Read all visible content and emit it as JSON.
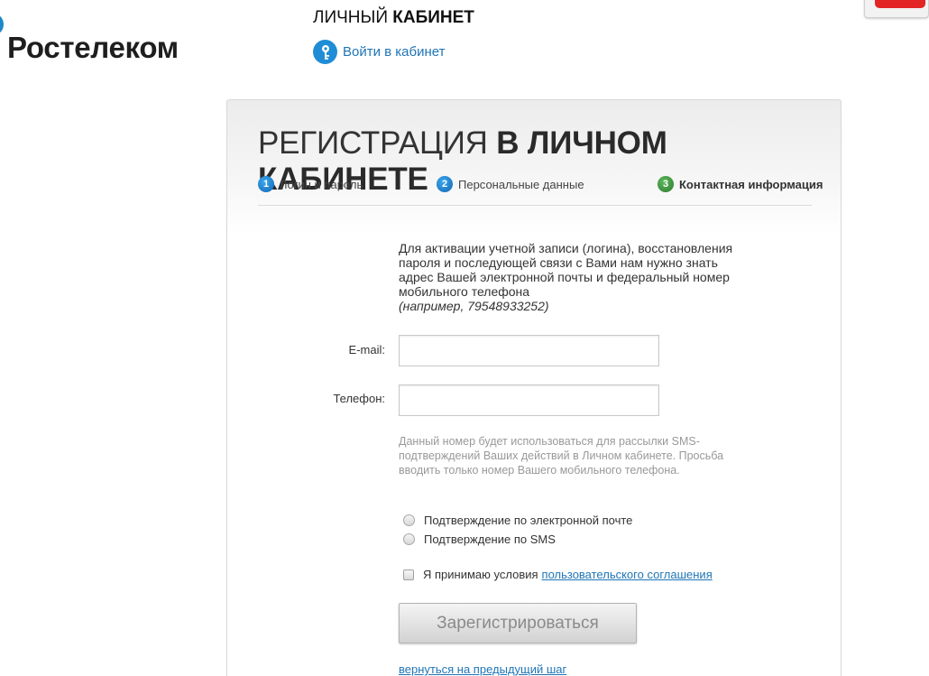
{
  "header": {
    "logo_text": "Ростелеком",
    "cabinet_title_light": "ЛИЧНЫЙ",
    "cabinet_title_bold": "КАБИНЕТ",
    "login_link": "Войти в кабинет"
  },
  "registration": {
    "title_light": "РЕГИСТРАЦИЯ",
    "title_bold": "В ЛИЧНОМ КАБИНЕТЕ",
    "steps": [
      {
        "num": "1",
        "label": "Логин и пароль",
        "active": false
      },
      {
        "num": "2",
        "label": "Персональные данные",
        "active": false
      },
      {
        "num": "3",
        "label": "Контактная информация",
        "active": true
      }
    ],
    "intro_text": "Для активации учетной записи (логина), восстановления пароля и последующей связи с Вами нам нужно знать адрес Вашей электронной почты и федеральный номер мобильного телефона",
    "intro_example": "(например, 79548933252)",
    "email_label": "E-mail:",
    "email_value": "",
    "phone_label": "Телефон:",
    "phone_value": "",
    "phone_hint": "Данный номер будет использоваться для рассылки SMS-подтверждений Ваших действий в Личном кабинете. Просьба вводить только номер Вашего мобильного телефона.",
    "confirm_options": [
      {
        "label": "Подтверждение по электронной почте",
        "checked": false
      },
      {
        "label": "Подтверждение по SMS",
        "checked": false
      }
    ],
    "agree_text": "Я принимаю условия",
    "agree_link": "пользовательского соглашения",
    "submit_label": "Зарегистрироваться",
    "back_link": "вернуться на предыдущий шаг"
  },
  "colors": {
    "link": "#1f75b6",
    "step_blue": "#1f8dd6",
    "step_green": "#2d7a2d"
  }
}
